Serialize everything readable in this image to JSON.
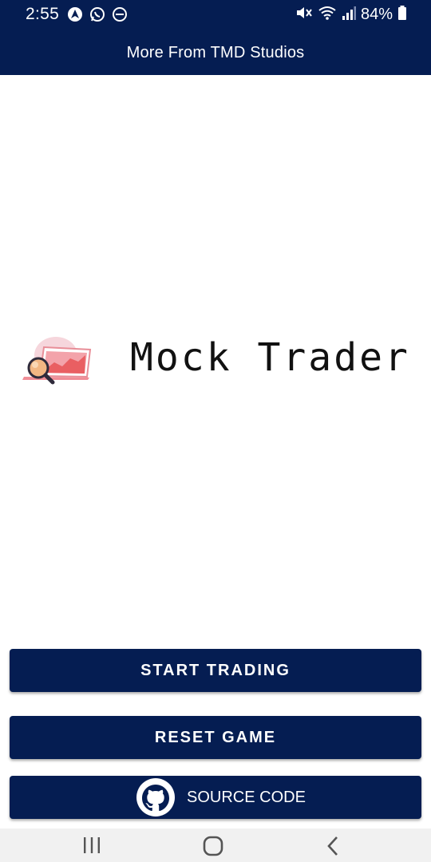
{
  "status_bar": {
    "time": "2:55",
    "battery": "84%",
    "left_icons": [
      "nav-arrow-icon",
      "whatsapp-icon",
      "dnd-icon"
    ],
    "right_icons": [
      "mute-icon",
      "wifi-icon",
      "signal-icon",
      "battery-icon"
    ]
  },
  "header": {
    "title": "More From TMD Studios"
  },
  "logo": {
    "title": "Mock Trader",
    "icon": "laptop-magnifier-icon"
  },
  "buttons": {
    "start": "START TRADING",
    "reset": "RESET GAME",
    "source": "SOURCE CODE",
    "source_icon": "github-icon"
  },
  "nav_bar": {
    "icons": [
      "recents-icon",
      "home-icon",
      "back-icon"
    ]
  },
  "colors": {
    "primary": "#051d52",
    "background": "#ffffff",
    "nav_bar": "#f1f1f1"
  }
}
